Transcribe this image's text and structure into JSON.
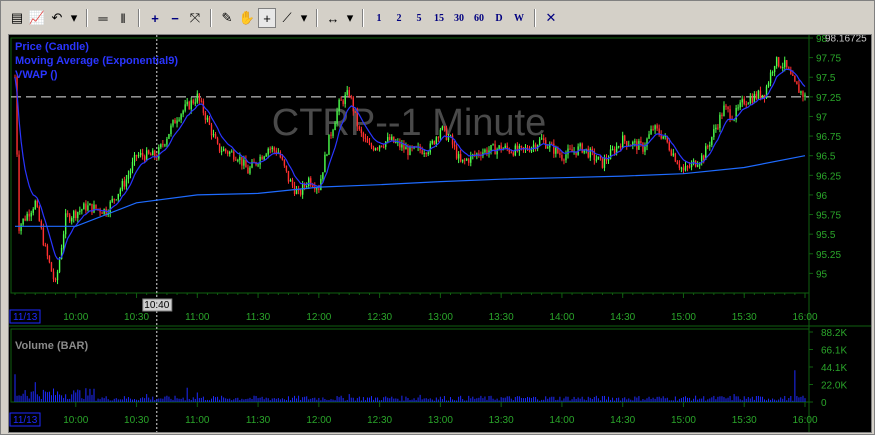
{
  "toolbar": {
    "buttons": [
      {
        "name": "chart-type-icon",
        "glyph": "▤"
      },
      {
        "name": "indicator-icon",
        "glyph": "📈"
      },
      {
        "name": "undo-icon",
        "glyph": "↶"
      },
      {
        "name": "dropdown-icon",
        "glyph": "▾"
      },
      {
        "sep": true
      },
      {
        "name": "hline-icon",
        "glyph": "═"
      },
      {
        "name": "vline-icon",
        "glyph": "‖"
      },
      {
        "sep": true
      },
      {
        "name": "zoom-in-icon",
        "glyph": "+"
      },
      {
        "name": "zoom-out-icon",
        "glyph": "−"
      },
      {
        "name": "fit-icon",
        "glyph": "⤧"
      },
      {
        "sep": true
      },
      {
        "name": "draw-icon",
        "glyph": "✎"
      },
      {
        "name": "hand-icon",
        "glyph": "✋"
      },
      {
        "name": "crosshair-icon",
        "glyph": "+",
        "pressed": true
      },
      {
        "name": "trendline-icon",
        "glyph": "⟋"
      },
      {
        "name": "dropdown-icon",
        "glyph": "▾"
      },
      {
        "sep": true
      },
      {
        "name": "pan-icon",
        "glyph": "↔"
      },
      {
        "name": "dropdown-icon",
        "glyph": "▾"
      }
    ],
    "intervals": [
      "1",
      "2",
      "5",
      "15",
      "30",
      "60",
      "D",
      "W"
    ],
    "close_glyph": "✕"
  },
  "chart_data": {
    "type": "candlestick",
    "title": "CTRP--1 Minute",
    "legend": [
      "Price (Candle)",
      "Moving Average (Exponential9)",
      "VWAP ()"
    ],
    "price_axis": {
      "ticks": [
        95,
        95.25,
        95.5,
        95.75,
        96,
        96.25,
        96.5,
        96.75,
        97,
        97.25,
        97.5,
        97.75,
        98
      ],
      "range": [
        94.75,
        98.0
      ],
      "readout": "98.16725"
    },
    "time_axis": {
      "date_label": "11/13",
      "ticks": [
        "10:00",
        "10:30",
        "11:00",
        "11:30",
        "12:00",
        "12:30",
        "13:00",
        "13:30",
        "14:00",
        "14:30",
        "15:00",
        "15:30",
        "16:00"
      ],
      "cursor_label": "10:40"
    },
    "horizontal_line_price": 97.25,
    "price_path": [
      [
        "09:30",
        97.5
      ],
      [
        "09:32",
        95.6
      ],
      [
        "09:40",
        95.9
      ],
      [
        "09:45",
        95.3
      ],
      [
        "09:50",
        94.85
      ],
      [
        "09:55",
        95.7
      ],
      [
        "10:05",
        95.85
      ],
      [
        "10:15",
        95.8
      ],
      [
        "10:25",
        96.2
      ],
      [
        "10:30",
        96.5
      ],
      [
        "10:40",
        96.5
      ],
      [
        "10:50",
        97.0
      ],
      [
        "11:00",
        97.25
      ],
      [
        "11:05",
        96.95
      ],
      [
        "11:10",
        96.6
      ],
      [
        "11:20",
        96.5
      ],
      [
        "11:25",
        96.3
      ],
      [
        "11:35",
        96.6
      ],
      [
        "11:40",
        96.55
      ],
      [
        "11:45",
        96.2
      ],
      [
        "11:50",
        96.0
      ],
      [
        "11:55",
        96.2
      ],
      [
        "12:00",
        96.1
      ],
      [
        "12:05",
        96.7
      ],
      [
        "12:10",
        97.15
      ],
      [
        "12:15",
        97.3
      ],
      [
        "12:20",
        96.8
      ],
      [
        "12:25",
        96.6
      ],
      [
        "12:35",
        96.7
      ],
      [
        "12:45",
        96.55
      ],
      [
        "12:55",
        96.6
      ],
      [
        "13:00",
        96.85
      ],
      [
        "13:05",
        96.7
      ],
      [
        "13:10",
        96.4
      ],
      [
        "13:20",
        96.55
      ],
      [
        "13:30",
        96.6
      ],
      [
        "13:40",
        96.55
      ],
      [
        "13:50",
        96.7
      ],
      [
        "14:00",
        96.5
      ],
      [
        "14:10",
        96.6
      ],
      [
        "14:20",
        96.4
      ],
      [
        "14:30",
        96.7
      ],
      [
        "14:40",
        96.6
      ],
      [
        "14:45",
        96.85
      ],
      [
        "14:50",
        96.75
      ],
      [
        "15:00",
        96.3
      ],
      [
        "15:10",
        96.5
      ],
      [
        "15:20",
        97.1
      ],
      [
        "15:25",
        97.0
      ],
      [
        "15:30",
        97.2
      ],
      [
        "15:40",
        97.3
      ],
      [
        "15:45",
        97.7
      ],
      [
        "15:50",
        97.65
      ],
      [
        "15:55",
        97.4
      ],
      [
        "16:00",
        97.25
      ]
    ],
    "vwap": [
      [
        "09:30",
        95.6
      ],
      [
        "10:00",
        95.6
      ],
      [
        "10:30",
        95.9
      ],
      [
        "11:00",
        96.0
      ],
      [
        "11:30",
        96.02
      ],
      [
        "12:00",
        96.1
      ],
      [
        "12:30",
        96.13
      ],
      [
        "13:00",
        96.17
      ],
      [
        "13:30",
        96.2
      ],
      [
        "14:00",
        96.22
      ],
      [
        "14:30",
        96.24
      ],
      [
        "15:00",
        96.27
      ],
      [
        "15:30",
        96.35
      ],
      [
        "16:00",
        96.5
      ]
    ],
    "volume": {
      "title": "Volume (BAR)",
      "ticks": [
        "88.2K",
        "66.1K",
        "44.1K",
        "22.0K",
        "0"
      ],
      "ylim": [
        0,
        88.2
      ],
      "unit": "K",
      "spikes": [
        [
          "09:30",
          35
        ],
        [
          "09:35",
          15
        ],
        [
          "09:40",
          25
        ],
        [
          "10:00",
          12
        ],
        [
          "10:35",
          10
        ],
        [
          "10:55",
          18
        ],
        [
          "11:00",
          12
        ],
        [
          "12:15",
          10
        ],
        [
          "12:50",
          9
        ],
        [
          "15:25",
          10
        ],
        [
          "15:55",
          40
        ]
      ],
      "base_level": 4
    }
  },
  "colors": {
    "up": "#4cff4c",
    "down": "#ff3030",
    "ma": "#2a35ff",
    "vwap": "#1e6bff",
    "grid": "#0f5f0f",
    "axis_text": "#2aa52a",
    "volume": "#1e2aff",
    "title": "#4a4a4a"
  }
}
